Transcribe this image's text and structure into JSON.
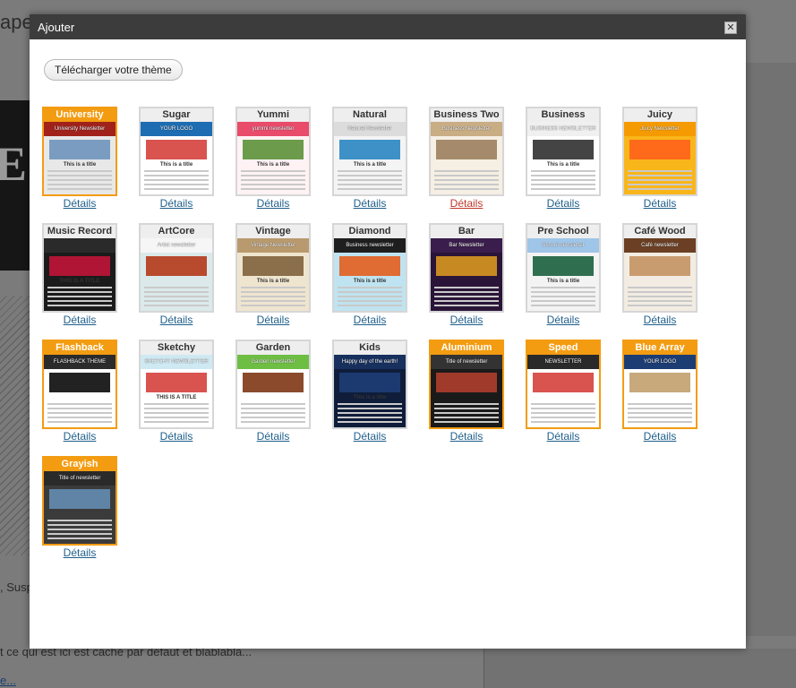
{
  "background": {
    "title_fragment": "ape",
    "text_line_1": ", Susp",
    "text_line_2": "t ce qui est ici est caché par défaut et blablabla...",
    "link_fragment": "e..."
  },
  "dialog": {
    "title": "Ajouter",
    "close_symbol": "✕",
    "upload_button": "Télécharger votre thème"
  },
  "details_label": "Détails",
  "themes": [
    {
      "name": "University",
      "selected": true,
      "accent": "#f39c12",
      "preview": {
        "bg": "#e8e8e8",
        "header": "#a0221b",
        "image": "#7a9cc0",
        "banner_text": "University Newsletter",
        "title_text": "This is a title"
      }
    },
    {
      "name": "Sugar",
      "selected": false,
      "preview": {
        "bg": "#ffffff",
        "header": "#1e6db3",
        "image": "#d9534f",
        "banner_text": "YOUR LOGO",
        "title_text": "This is a title"
      }
    },
    {
      "name": "Yummi",
      "selected": false,
      "preview": {
        "bg": "#fff2f4",
        "header": "#e94b6b",
        "image": "#6b9b4b",
        "banner_text": "yummi newsletter",
        "title_text": "This is a title"
      }
    },
    {
      "name": "Natural",
      "selected": false,
      "preview": {
        "bg": "#f4f4f4",
        "header": "#dcdcdc",
        "image": "#3e91c7",
        "banner_text": "Natural Newsletter",
        "title_text": "This is a title"
      }
    },
    {
      "name": "Business Two",
      "selected": false,
      "preview": {
        "bg": "#f5efe4",
        "header": "#c9ad84",
        "image": "#a58b6c",
        "banner_text": "Business Newsletter",
        "title_text": ""
      }
    },
    {
      "name": "Business",
      "selected": false,
      "preview": {
        "bg": "#ffffff",
        "header": "#f0f0f0",
        "image": "#444444",
        "banner_text": "BUSINESS NEWSLETTER",
        "title_text": "This is a title"
      }
    },
    {
      "name": "Juicy",
      "selected": false,
      "preview": {
        "bg": "#f9b61a",
        "header": "#f59a00",
        "image": "#ff6a1a",
        "banner_text": "Juicy Newsletter",
        "title_text": ""
      }
    },
    {
      "name": "Music Record",
      "selected": false,
      "preview": {
        "bg": "#1b1b1b",
        "header": "#2a2a2a",
        "image": "#b01535",
        "banner_text": "",
        "title_text": "THIS IS A TITLE"
      }
    },
    {
      "name": "ArtCore",
      "selected": false,
      "preview": {
        "bg": "#dbe9ea",
        "header": "#f6f6f6",
        "image": "#b84a2e",
        "banner_text": "Artist newsletter",
        "title_text": ""
      }
    },
    {
      "name": "Vintage",
      "selected": false,
      "preview": {
        "bg": "#efe5cf",
        "header": "#b99a6e",
        "image": "#8a6f4a",
        "banner_text": "Vintage Newsletter",
        "title_text": "This is a title"
      }
    },
    {
      "name": "Diamond",
      "selected": false,
      "preview": {
        "bg": "#bfe3f0",
        "header": "#1e1e1e",
        "image": "#e06b33",
        "banner_text": "Business newsletter",
        "title_text": "This is a title"
      }
    },
    {
      "name": "Bar",
      "selected": false,
      "preview": {
        "bg": "#2a1438",
        "header": "#3a1d4c",
        "image": "#c78a22",
        "banner_text": "Bar Newsletter",
        "title_text": ""
      }
    },
    {
      "name": "Pre School",
      "selected": false,
      "preview": {
        "bg": "#f3f3f3",
        "header": "#9fc5e8",
        "image": "#2f6f4f",
        "banner_text": "School newsletter",
        "title_text": "This is a title"
      }
    },
    {
      "name": "Café Wood",
      "selected": false,
      "preview": {
        "bg": "#f3ece3",
        "header": "#6b3f24",
        "image": "#c99c6f",
        "banner_text": "Café newsletter",
        "title_text": ""
      }
    },
    {
      "name": "Flashback",
      "selected": true,
      "accent": "#f39c12",
      "preview": {
        "bg": "#ffffff",
        "header": "#2b2b2b",
        "image": "#222222",
        "banner_text": "FLASHBACK THEME",
        "title_text": ""
      }
    },
    {
      "name": "Sketchy",
      "selected": false,
      "preview": {
        "bg": "#ffffff",
        "header": "#cfe9f3",
        "image": "#d9534f",
        "banner_text": "SKETCHY NEWSLETTER",
        "title_text": "THIS IS A TITLE"
      }
    },
    {
      "name": "Garden",
      "selected": false,
      "preview": {
        "bg": "#ffffff",
        "header": "#6fbe44",
        "image": "#8b4a2b",
        "banner_text": "Garden newsletter",
        "title_text": ""
      }
    },
    {
      "name": "Kids",
      "selected": false,
      "preview": {
        "bg": "#0f1d3a",
        "header": "#17305e",
        "image": "#1c3a70",
        "banner_text": "Happy day of the earth!",
        "title_text": "This is a title"
      }
    },
    {
      "name": "Aluminium",
      "selected": true,
      "accent": "#f39c12",
      "preview": {
        "bg": "#1a1a1a",
        "header": "#333333",
        "image": "#a03a2a",
        "banner_text": "Title of newsletter",
        "title_text": ""
      }
    },
    {
      "name": "Speed",
      "selected": true,
      "accent": "#f39c12",
      "preview": {
        "bg": "#ffffff",
        "header": "#2a2a2a",
        "image": "#d9534f",
        "banner_text": "NEWSLETTER",
        "title_text": ""
      }
    },
    {
      "name": "Blue Array",
      "selected": true,
      "accent": "#f39c12",
      "preview": {
        "bg": "#ffffff",
        "header": "#1c3d73",
        "image": "#c8a97c",
        "banner_text": "YOUR LOGO",
        "title_text": ""
      }
    },
    {
      "name": "Grayish",
      "selected": true,
      "accent": "#f39c12",
      "preview": {
        "bg": "#3b3b3b",
        "header": "#2a2a2a",
        "image": "#5f84a6",
        "banner_text": "Title of newsletter",
        "title_text": ""
      }
    }
  ]
}
